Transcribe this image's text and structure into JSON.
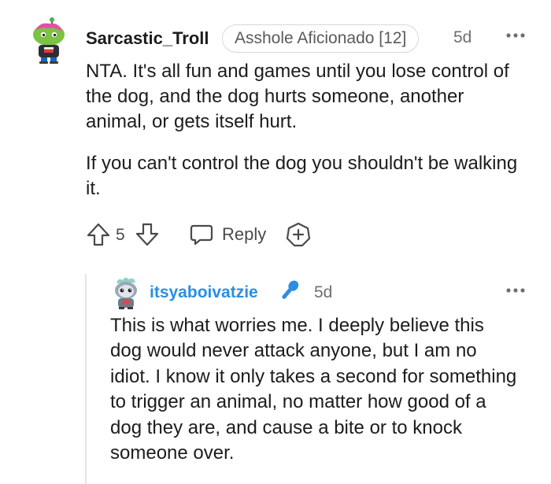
{
  "comment": {
    "username": "Sarcastic_Troll",
    "flair": "Asshole Aficionado [12]",
    "time": "5d",
    "more_icon": "more-horizontal-icon",
    "paragraphs": [
      "NTA. It's all fun and games until you lose control of the dog, and the dog hurts someone, another animal, or gets itself hurt.",
      "If you can't control the dog you shouldn't be walking it."
    ],
    "actions": {
      "upvote_icon": "arrow-up-icon",
      "score": "5",
      "downvote_icon": "arrow-down-icon",
      "reply_label": "Reply",
      "reply_icon": "chat-bubble-icon",
      "award_icon": "award-plus-icon"
    }
  },
  "reply": {
    "username": "itsyaboivatzie",
    "badge_icon": "microphone-icon",
    "time": "5d",
    "more_icon": "more-horizontal-icon",
    "text": "This is what worries me. I deeply believe this dog would never attack anyone, but I am no idiot. I know it only takes a second for something to trigger an animal, no matter how good of a dog they are, and cause a bite or to knock someone over."
  },
  "colors": {
    "username_reply": "#2a8fe0",
    "text": "#1c1c1c",
    "muted": "#6f6f6f",
    "mic": "#2a8fe0",
    "avatar_green": "#8ac13f",
    "avatar_pink": "#e64ea5"
  }
}
